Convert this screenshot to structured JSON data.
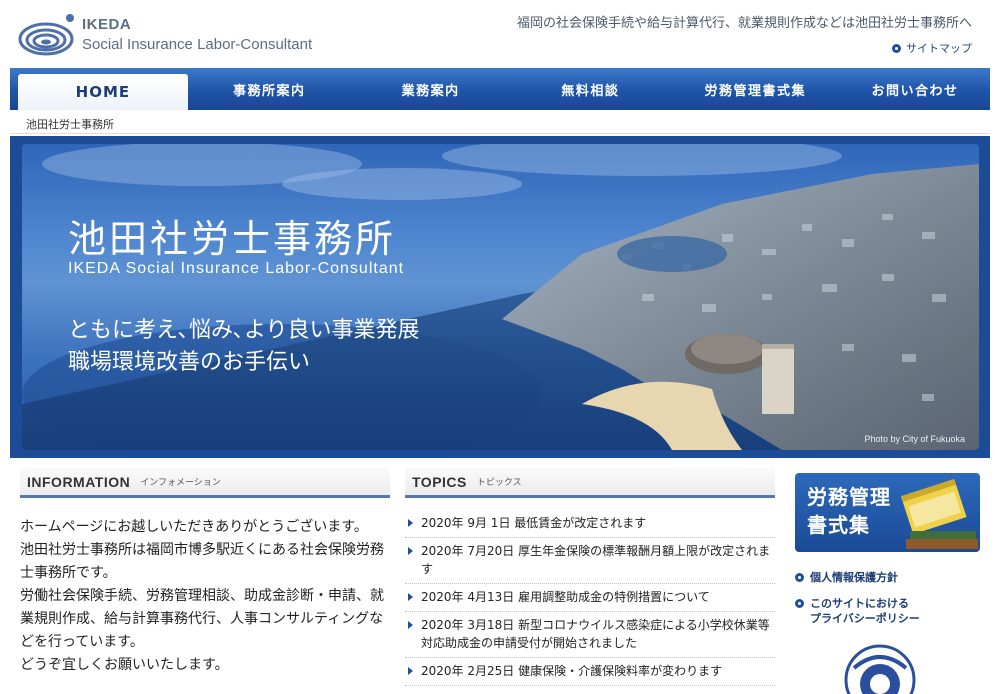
{
  "header": {
    "logo_name": "IKEDA",
    "logo_sub": "Social Insurance Labor-Consultant",
    "tagline": "福岡の社会保険手続や給与計算代行、就業規則作成などは池田社労士事務所へ",
    "sitemap": "サイトマップ"
  },
  "nav": {
    "items": [
      "HOME",
      "事務所案内",
      "業務案内",
      "無料相談",
      "労務管理書式集",
      "お問い合わせ"
    ]
  },
  "breadcrumb": "池田社労士事務所",
  "hero": {
    "title": "池田社労士事務所",
    "title_en": "IKEDA Social Insurance Labor-Consultant",
    "line1": "ともに考え､悩み､より良い事業発展",
    "line2": "職場環境改善のお手伝い",
    "credit": "Photo by City of Fukuoka"
  },
  "information": {
    "heading": "INFORMATION",
    "heading_jp": "インフォメーション",
    "paragraphs": [
      "ホームページにお越しいただきありがとうございます。",
      "池田社労士事務所は福岡市博多駅近くにある社会保険労務士事務所です。",
      "労働社会保険手続、労務管理相談、助成金診断・申請、就業規則作成、給与計算事務代行、人事コンサルティングなどを行っています。",
      "どうぞ宜しくお願いいたします。"
    ]
  },
  "topics": {
    "heading": "TOPICS",
    "heading_jp": "トピックス",
    "items": [
      "2020年 9月 1日 最低賃金が改定されます",
      "2020年 7月20日 厚生年金保険の標準報酬月額上限が改定されます",
      "2020年 4月13日 雇用調整助成金の特例措置について",
      "2020年 3月18日 新型コロナウイルス感染症による小学校休業等対応助成金の申請受付が開始されました",
      "2020年 2月25日 健康保険・介護保険料率が変わります"
    ]
  },
  "sidebar": {
    "forms_banner_line1": "労務管理",
    "forms_banner_line2": "書式集",
    "link_privacy": "個人情報保護方針",
    "link_site_policy_1": "このサイトにおける",
    "link_site_policy_2": "プライバシーポリシー"
  },
  "colors": {
    "nav_blue": "#1f54a8",
    "accent": "#1f4f9a"
  }
}
